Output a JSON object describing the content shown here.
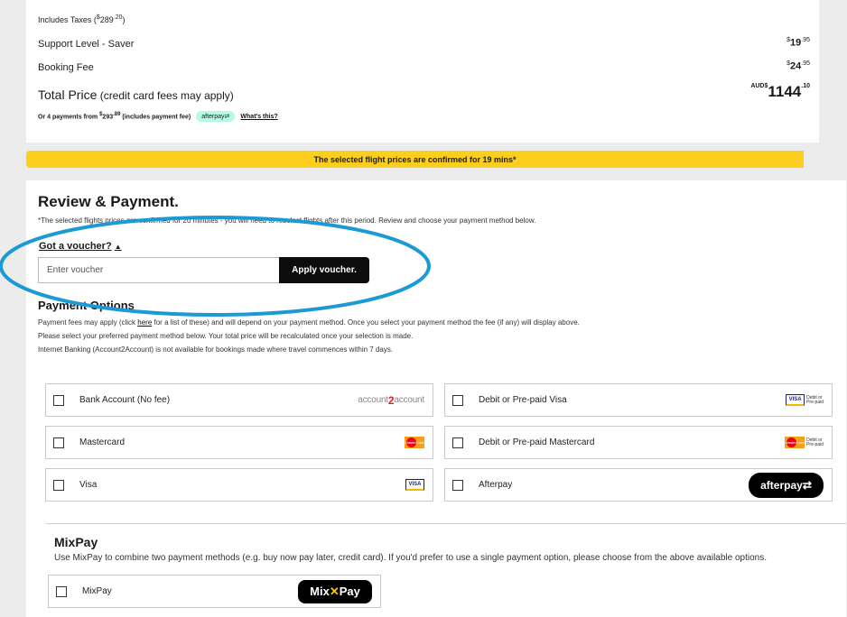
{
  "summary": {
    "taxes_label": "Includes Taxes (",
    "taxes_dollar": "$",
    "taxes_amount": "289",
    "taxes_cents": ".20",
    "taxes_close": ")",
    "support_label": "Support Level - Saver",
    "support_dollar": "$",
    "support_amount": "19",
    "support_cents": ".95",
    "booking_label": "Booking Fee",
    "booking_dollar": "$",
    "booking_amount": "24",
    "booking_cents": ".95",
    "total_label": "Total Price",
    "total_sub": " (credit card fees may apply)",
    "total_currency": "AUD$",
    "total_amount": "1144",
    "total_cents": ".10",
    "installment_prefix": "Or 4 payments from ",
    "installment_dollar": "$",
    "installment_amount": "293",
    "installment_cents": ".89",
    "installment_suffix": " (includes payment fee)",
    "afterpay_small": "afterpay⇄",
    "whats_this": "What's this?"
  },
  "banner": {
    "text": "The selected flight prices are confirmed for 19 mins*"
  },
  "review": {
    "title": "Review & Payment.",
    "note": "*The selected flights prices are confirmed for 20 minutes - you will need to reselect flights after this period. Review and choose your payment method below.",
    "voucher_toggle": "Got a voucher?",
    "voucher_caret": "▲",
    "voucher_placeholder": "Enter voucher",
    "apply_label": "Apply voucher."
  },
  "payment": {
    "title": "Payment Options",
    "desc1_pre": "Payment fees may apply (click ",
    "desc1_link": "here",
    "desc1_post": " for a list of these) and will depend on your payment method. Once you select your payment method the fee (if any) will display above.",
    "desc2": "Please select your preferred payment method below. Your total price will be recalculated once your selection is made.",
    "desc3": "Internet Banking (Account2Account) is not available for bookings made where travel commences within 7 days.",
    "options": [
      {
        "label": "Bank Account (No fee)",
        "logo": "account2account"
      },
      {
        "label": "Debit or Pre-paid Visa",
        "logo": "visa-debit"
      },
      {
        "label": "Mastercard",
        "logo": "mastercard"
      },
      {
        "label": "Debit or Pre-paid Mastercard",
        "logo": "mastercard-debit"
      },
      {
        "label": "Visa",
        "logo": "visa"
      },
      {
        "label": "Afterpay",
        "logo": "afterpay"
      }
    ],
    "logo_text": {
      "acc_pre": "account",
      "acc_mid": "2",
      "acc_post": "account",
      "visa": "VISA",
      "mc": "MasterCard",
      "debit": "Debit or",
      "prepaid": "Pre-paid",
      "afterpay": "afterpay⇄"
    }
  },
  "mixpay": {
    "title": "MixPay",
    "desc": "Use MixPay to combine two payment methods (e.g. buy now pay later, credit card). If you'd prefer to use a single payment option, please choose from the above available options.",
    "option_label": "MixPay",
    "badge_pre": "Mix",
    "badge_x": "✕",
    "badge_post": "Pay"
  },
  "colors": {
    "banner": "#fccf1e",
    "annotation": "#1b9ad6",
    "brand_dark": "#0c0c0c"
  }
}
